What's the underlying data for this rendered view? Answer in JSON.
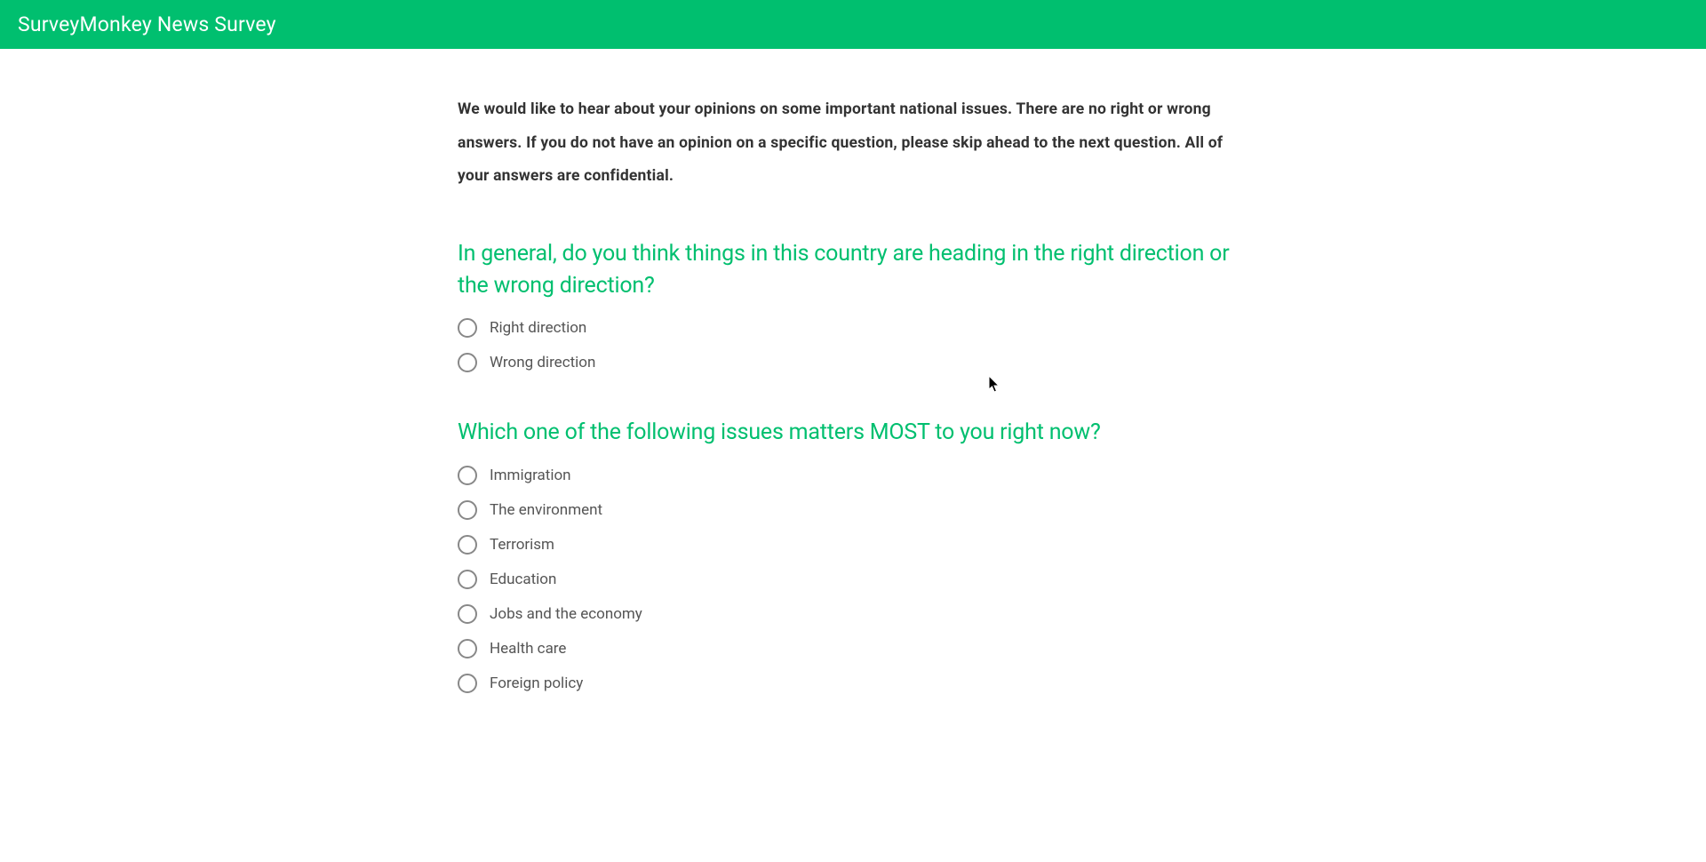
{
  "header": {
    "title": "SurveyMonkey News Survey"
  },
  "intro": "We would like to hear about your opinions on some important national issues. There are no right or wrong answers. If you do not have an opinion on a specific question, please skip ahead to the next question. All of your answers are confidential.",
  "questions": [
    {
      "title": "In general, do you think things in this country are heading in the right direction or the wrong direction?",
      "options": [
        "Right direction",
        "Wrong direction"
      ]
    },
    {
      "title": "Which one of the following issues matters MOST to you right now?",
      "options": [
        "Immigration",
        "The environment",
        "Terrorism",
        "Education",
        "Jobs and the economy",
        "Health care",
        "Foreign policy"
      ]
    }
  ]
}
